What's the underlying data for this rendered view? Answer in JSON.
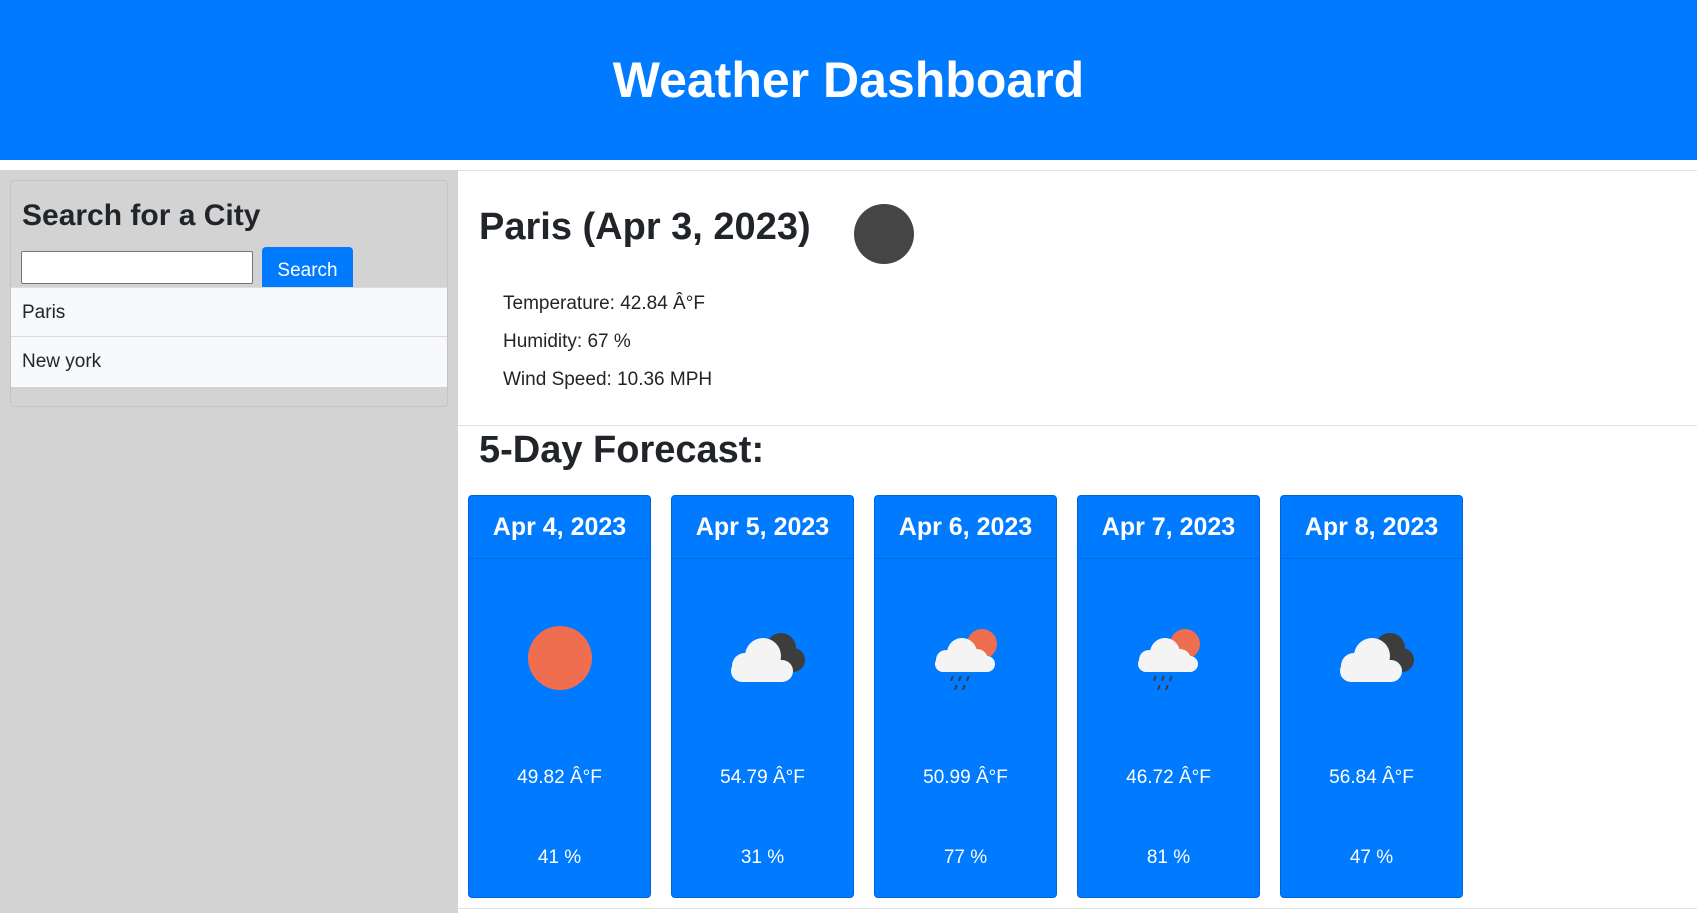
{
  "header": {
    "title": "Weather Dashboard"
  },
  "search": {
    "heading": "Search for a City",
    "input_value": "",
    "button_label": "Search"
  },
  "history": [
    "Paris",
    "New york"
  ],
  "current": {
    "title": "Paris (Apr 3, 2023)",
    "icon": "night-clear-icon",
    "temperature": "Temperature: 42.84 Â°F",
    "humidity": "Humidity: 67 %",
    "wind": "Wind Speed: 10.36 MPH"
  },
  "forecast": {
    "title": "5-Day Forecast:",
    "days": [
      {
        "date": "Apr 4, 2023",
        "icon": "sun-icon",
        "temp": "49.82 Â°F",
        "humidity": "41 %"
      },
      {
        "date": "Apr 5, 2023",
        "icon": "cloudy-icon",
        "temp": "54.79 Â°F",
        "humidity": "31 %"
      },
      {
        "date": "Apr 6, 2023",
        "icon": "rain-icon",
        "temp": "50.99 Â°F",
        "humidity": "77 %"
      },
      {
        "date": "Apr 7, 2023",
        "icon": "rain-icon",
        "temp": "46.72 Â°F",
        "humidity": "81 %"
      },
      {
        "date": "Apr 8, 2023",
        "icon": "cloudy-icon",
        "temp": "56.84 Â°F",
        "humidity": "47 %"
      }
    ]
  },
  "colors": {
    "primary": "#007bff",
    "sun": "#ee6e4f",
    "moon": "#454545",
    "sidebar": "#d3d3d3"
  }
}
